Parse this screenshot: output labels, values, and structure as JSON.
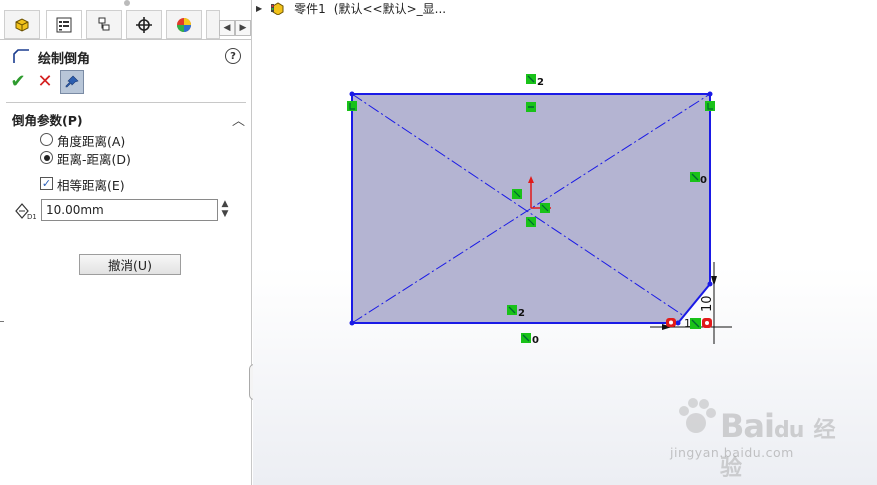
{
  "property_manager": {
    "title": "绘制倒角",
    "help_glyph": "?",
    "ok_glyph": "✔",
    "cancel_glyph": "✕",
    "pin_glyph": "📌",
    "group_title": "倒角参数(P)",
    "collapse_glyph": "︿",
    "options": [
      {
        "label": "角度距离(A)",
        "selected": false
      },
      {
        "label": "距离-距离(D)",
        "selected": true
      }
    ],
    "equal_distance": {
      "label": "相等距离(E)",
      "checked": true,
      "glyph": "✓"
    },
    "distance_value": "10.00mm",
    "spin_glyph": "▲▼",
    "undo_label": "撤消(U)",
    "tabs": [
      "feature-manager",
      "property-manager",
      "configuration-manager",
      "dimxpert",
      "display-manager",
      "more"
    ],
    "nav_prev": "◀",
    "nav_next": "▶",
    "splitter_glyph": "›"
  },
  "feature_tree": {
    "arrow": "▶",
    "part_name": "零件1",
    "config_text": "(默认<<默认>_显..."
  },
  "sketch": {
    "relations": {
      "top_horizontal": "2",
      "bottom_horizontal": "2",
      "right_vertical": "0",
      "bottom_fix": "0"
    },
    "dimension_value": "10",
    "chamfer_label": "10",
    "colors": {
      "sketch_line": "#1a1ae6",
      "fill": "#b0b0d0",
      "relation_green": "#19c219",
      "relation_red": "#e11a1a"
    }
  },
  "watermark": {
    "brand": "Bai",
    "suffix": "经验",
    "url": "jingyan.baidu.com"
  }
}
